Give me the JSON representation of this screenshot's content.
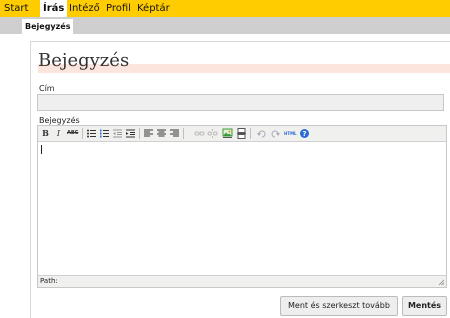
{
  "topnav": {
    "items": [
      "Start",
      "Írás",
      "Intéző",
      "Profil",
      "Képtár"
    ],
    "active_index": 1
  },
  "subtabs": [
    "Bejegyzés"
  ],
  "page": {
    "heading": "Bejegyzés",
    "title_label": "Cím",
    "title_value": "",
    "body_label": "Bejegyzés"
  },
  "editor": {
    "toolbar": [
      "bold",
      "italic",
      "strikethrough",
      "bullet-list",
      "numbered-list",
      "outdent",
      "indent",
      "align-left",
      "align-center",
      "align-right",
      "link",
      "unlink",
      "image",
      "page-break",
      "undo",
      "redo",
      "html",
      "help"
    ],
    "status_path": "Path:"
  },
  "buttons": {
    "save_continue": "Ment és szerkeszt tovább",
    "save": "Mentés"
  },
  "colors": {
    "nav_bar": "#ffcc00",
    "sub_bar": "#cfcfcf",
    "heading_band": "#fbe5dc",
    "help_icon": "#2a6bd6",
    "image_icon": "#3a9a3a"
  },
  "icons": {
    "bold": "B",
    "italic": "I",
    "strikethrough": "ABC",
    "html": "HTML",
    "help": "?"
  }
}
